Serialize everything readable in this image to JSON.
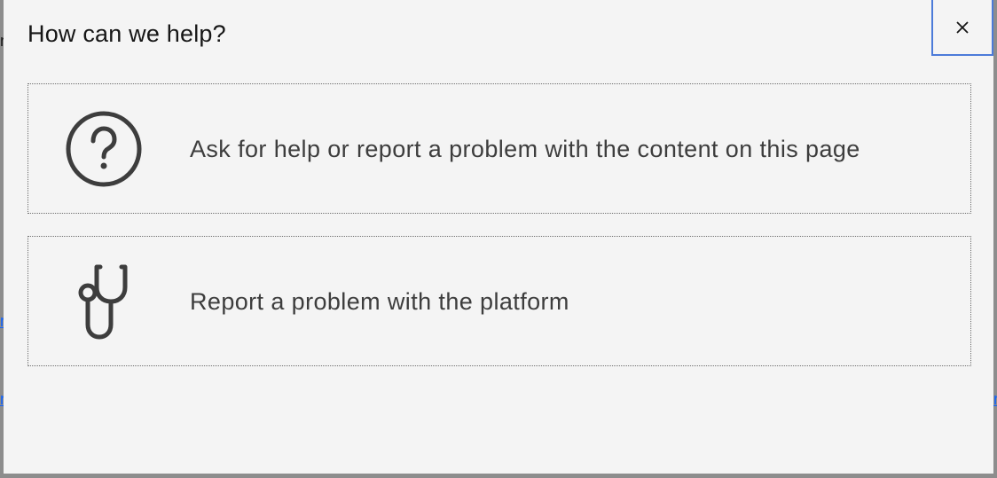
{
  "dialog": {
    "title": "How can we help?",
    "close_label": "×",
    "options": [
      {
        "label": "Ask for help or report a problem with the content on this page",
        "icon": "help-circle-icon"
      },
      {
        "label": "Report a problem with the platform",
        "icon": "stethoscope-icon"
      }
    ]
  },
  "background": {
    "fragments": [
      "n",
      "n",
      "n",
      "n"
    ]
  },
  "colors": {
    "overlay": "#8d8d8d",
    "modal_bg": "#f4f4f4",
    "text_primary": "#161616",
    "text_secondary": "#3d3d3d",
    "focus_border": "#4c7bd9",
    "link": "#0f62fe"
  }
}
